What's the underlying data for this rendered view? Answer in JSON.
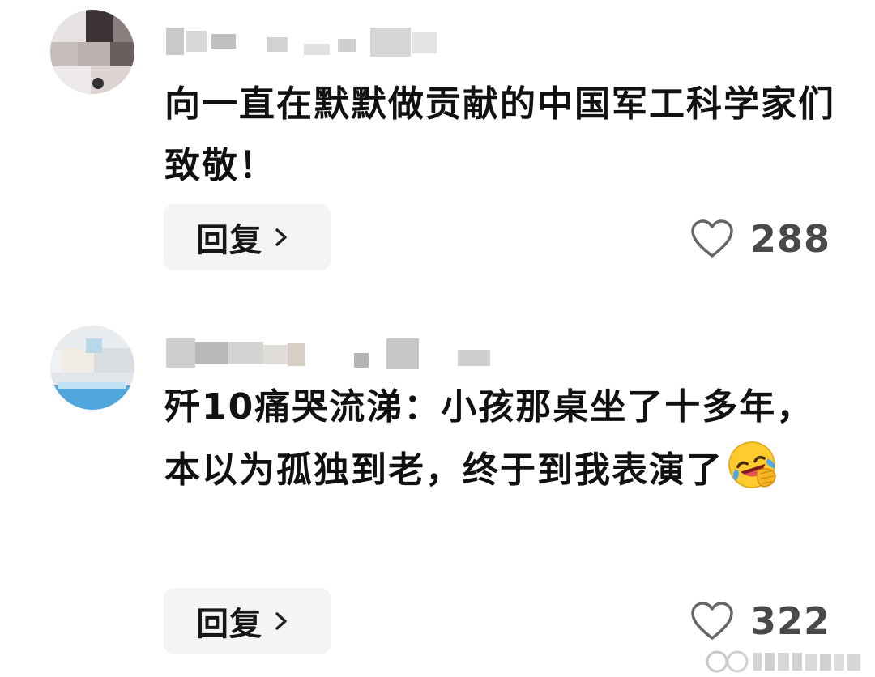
{
  "comments": [
    {
      "text": "向一直在默默做贡献的中国军工科学家们致敬！",
      "reply_label": "回复",
      "like_count": "288"
    },
    {
      "text": "歼10痛哭流涕：小孩那桌坐了十多年，本以为孤独到老，终于到我表演了",
      "emoji": "rolling-on-floor-laughing-emoji",
      "reply_label": "回复",
      "like_count": "322"
    }
  ],
  "icons": {
    "like": "heart-outline-icon",
    "reply_arrow": "chevron-right-icon"
  },
  "colors": {
    "reply_bg": "#f4f4f4",
    "like_count": "#4a4a4a",
    "text": "#111111"
  }
}
